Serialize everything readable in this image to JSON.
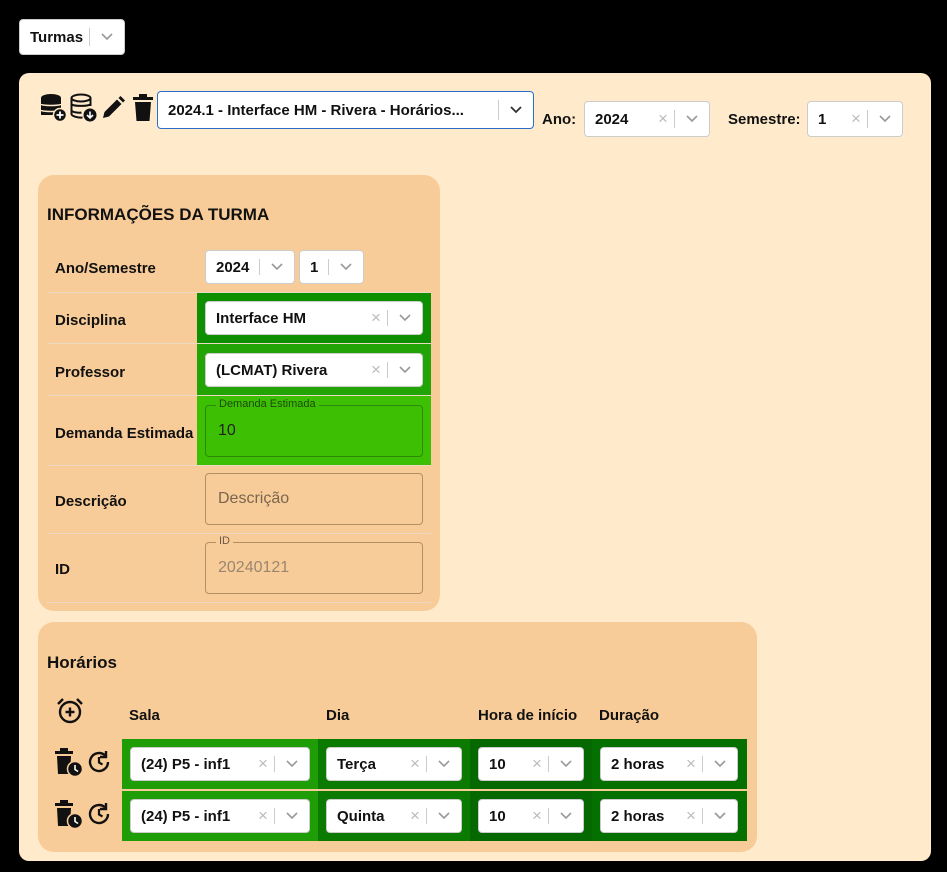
{
  "top_selector": {
    "value": "Turmas"
  },
  "toolbar": {
    "turma_select": {
      "value": "2024.1 - Interface HM - Rivera - Horários..."
    },
    "ano": {
      "label": "Ano:",
      "value": "2024"
    },
    "semestre": {
      "label": "Semestre:",
      "value": "1"
    },
    "icons": [
      "database-add-icon",
      "database-download-icon",
      "pencil-icon",
      "trash-icon"
    ]
  },
  "info": {
    "title": "INFORMAÇÕES DA TURMA",
    "ano_semestre": {
      "label": "Ano/Semestre",
      "ano": "2024",
      "semestre": "1"
    },
    "disciplina": {
      "label": "Disciplina",
      "value": "Interface HM"
    },
    "professor": {
      "label": "Professor",
      "value": "(LCMAT) Rivera"
    },
    "demanda": {
      "label": "Demanda Estimada",
      "legend": "Demanda Estimada",
      "value": "10"
    },
    "descricao": {
      "label": "Descrição",
      "placeholder": "Descrição"
    },
    "id": {
      "label": "ID",
      "legend": "ID",
      "value": "20240121"
    }
  },
  "horarios": {
    "title": "Horários",
    "columns": {
      "sala": "Sala",
      "dia": "Dia",
      "hora": "Hora de início",
      "duracao": "Duração"
    },
    "rows": [
      {
        "sala": "(24) P5 - inf1",
        "dia": "Terça",
        "hora": "10",
        "duracao": "2 horas"
      },
      {
        "sala": "(24) P5 - inf1",
        "dia": "Quinta",
        "hora": "10",
        "duracao": "2 horas"
      }
    ]
  },
  "colors": {
    "panel": "#ffebcc",
    "card": "#f8cc98",
    "green_bright": "#22a306",
    "green_dark": "#047000",
    "accent": "#2c6ecb"
  }
}
